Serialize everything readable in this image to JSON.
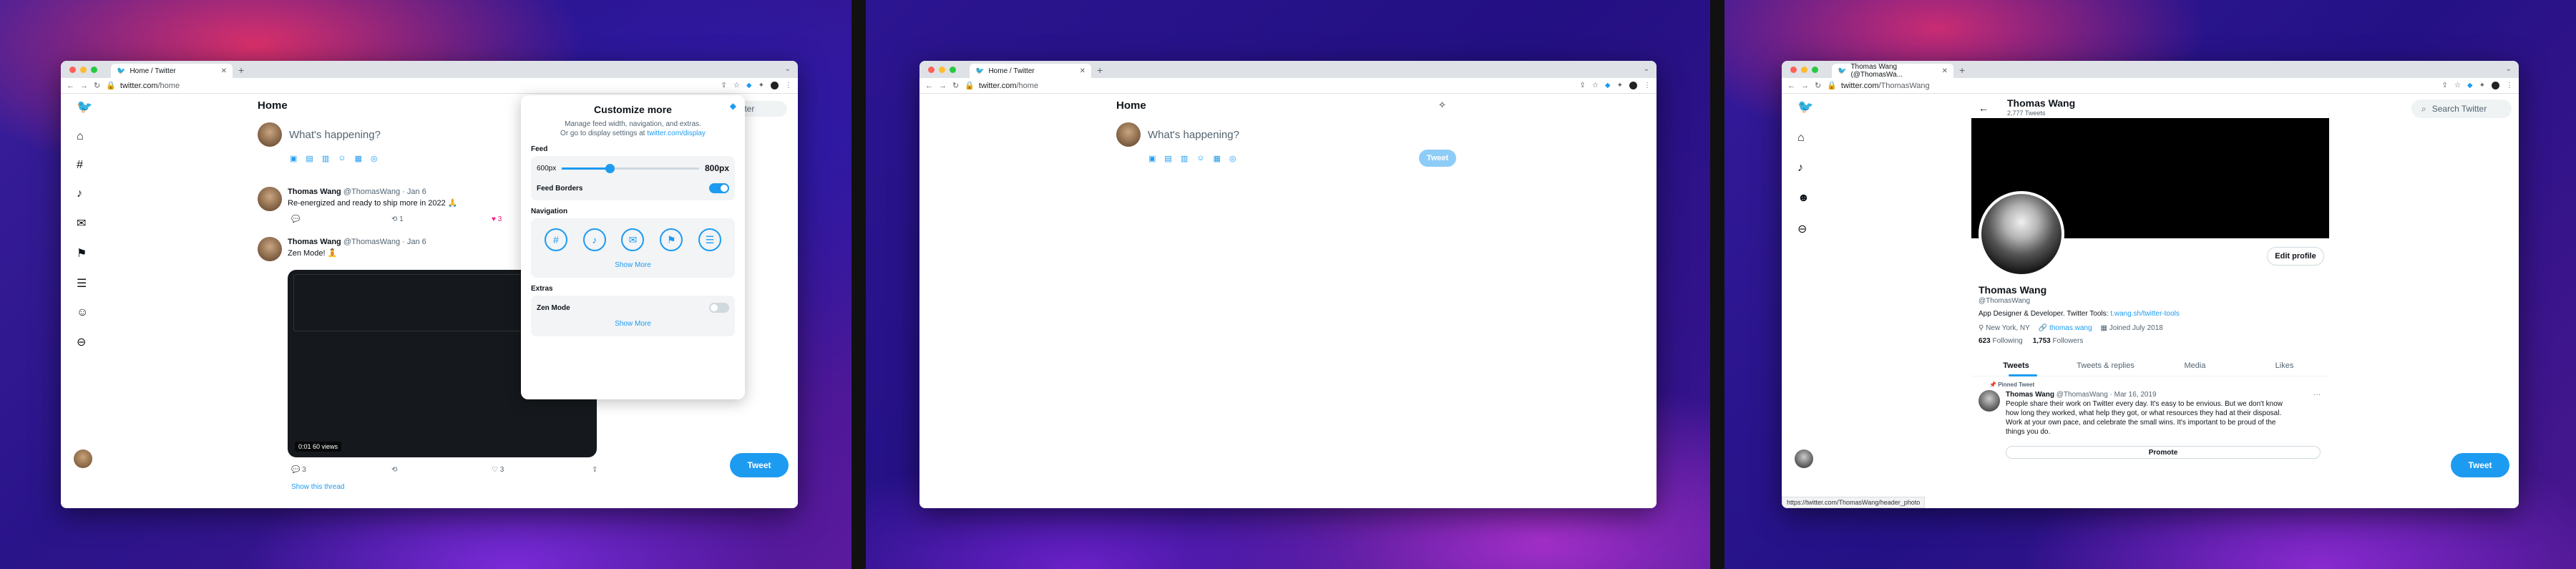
{
  "colors": {
    "brand": "#1d9bf0",
    "red": "#ff5f57",
    "yellow": "#febc2e",
    "green": "#28c840",
    "like": "#f91880"
  },
  "panel1": {
    "tab_title": "Home / Twitter",
    "url_domain": "twitter.com",
    "url_path": "/home",
    "page_title": "Home",
    "compose_placeholder": "What's happening?",
    "search_label": "Twitter",
    "tweets": [
      {
        "name": "Thomas Wang",
        "handle": "@ThomasWang · Jan 6",
        "text": "Re-energized and ready to ship more in 2022 🙏",
        "reply": "",
        "retweet": "1",
        "like": "3"
      },
      {
        "name": "Thomas Wang",
        "handle": "@ThomasWang · Jan 6",
        "text": "Zen Mode! 🧘",
        "reply": "3",
        "retweet": "",
        "like": "3"
      }
    ],
    "video_label": "0:01  60 views",
    "show_thread": "Show this thread",
    "tweet_button": "Tweet",
    "customize": {
      "title": "Customize more",
      "desc1": "Manage feed width, navigation, and extras.",
      "desc2": "Or go to display settings at",
      "desc_link": "twitter.com/display",
      "feed_heading": "Feed",
      "slider_min": "600px",
      "slider_value": "800px",
      "slider_fraction": 0.35,
      "feed_borders": "Feed Borders",
      "nav_heading": "Navigation",
      "show_more": "Show More",
      "extras_heading": "Extras",
      "zen_mode": "Zen Mode",
      "show_more2": "Show More"
    }
  },
  "panel2": {
    "tab_title": "Home / Twitter",
    "url_domain": "twitter.com",
    "url_path": "/home",
    "page_title": "Home",
    "compose_placeholder": "What's happening?",
    "tweet_button": "Tweet"
  },
  "panel3": {
    "tab_title": "Thomas Wang (@ThomasWa...",
    "url_domain": "twitter.com",
    "url_path": "/ThomasWang",
    "header_name": "Thomas Wang",
    "header_count": "2,777 Tweets",
    "search_placeholder": "Search Twitter",
    "edit_profile": "Edit profile",
    "name": "Thomas Wang",
    "handle": "@ThomasWang",
    "bio": "App Designer & Developer. Twitter Tools:",
    "bio_link": "t.wang.sh/twitter-tools",
    "location": "New York, NY",
    "website": "thomas.wang",
    "joined": "Joined July 2018",
    "following_count": "623",
    "following_label": "Following",
    "followers_count": "1,753",
    "followers_label": "Followers",
    "tabs": [
      "Tweets",
      "Tweets & replies",
      "Media",
      "Likes"
    ],
    "pinned_label": "Pinned Tweet",
    "pinned_meta_name": "Thomas Wang",
    "pinned_meta_rest": "@ThomasWang · Mar 16, 2019",
    "pinned_text": [
      "People share their work on Twitter every day. It's easy to be envious. But we don't know",
      "how long they worked, what help they got, or what resources they had at their disposal.",
      "Work at your own pace, and celebrate the small wins. It's important to be proud of the",
      "things you do."
    ],
    "promote": "Promote",
    "status_url": "https://twitter.com/ThomasWang/header_photo",
    "tweet_button": "Tweet"
  }
}
